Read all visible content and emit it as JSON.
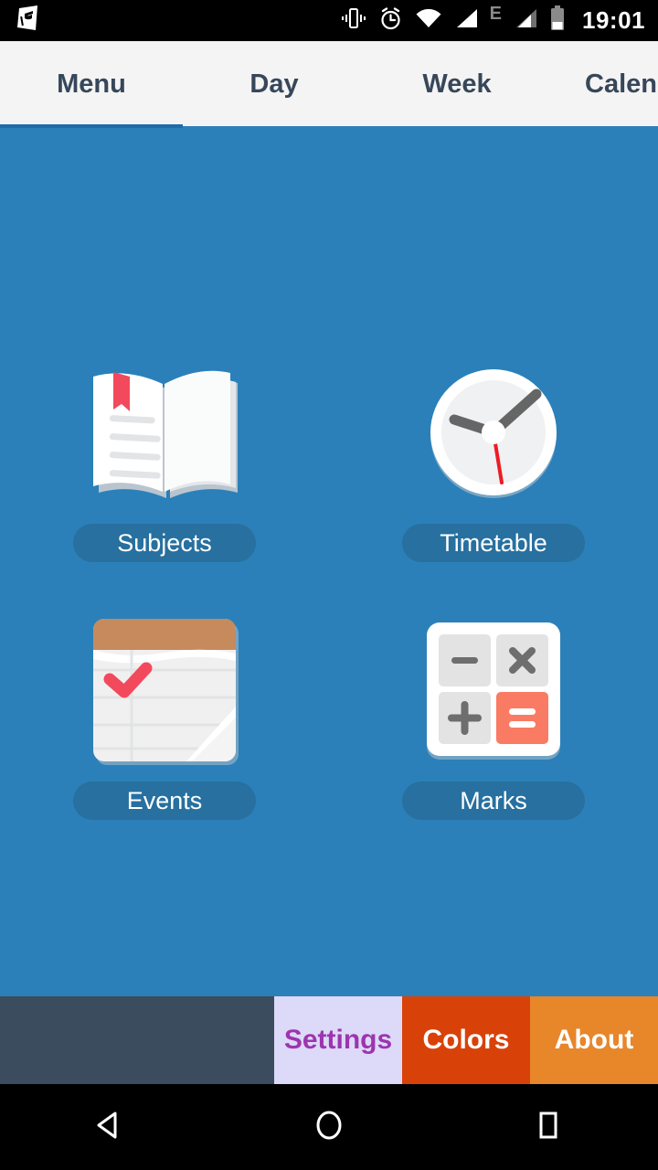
{
  "statusbar": {
    "app_notification_icon": "graduation-cap-icon",
    "icons": [
      "vibrate-icon",
      "alarm-icon",
      "wifi-icon",
      "signal-icon",
      "edge-network-icon",
      "signal-2-icon",
      "battery-icon"
    ],
    "network_label": "E",
    "time": "19:01"
  },
  "tabs": [
    {
      "label": "Menu",
      "active": true
    },
    {
      "label": "Day",
      "active": false
    },
    {
      "label": "Week",
      "active": false
    },
    {
      "label": "Calendar",
      "active": false
    }
  ],
  "menu": {
    "items": [
      {
        "label": "Subjects",
        "icon": "open-book-icon"
      },
      {
        "label": "Timetable",
        "icon": "clock-icon"
      },
      {
        "label": "Events",
        "icon": "notepad-check-icon"
      },
      {
        "label": "Marks",
        "icon": "calculator-icon"
      }
    ]
  },
  "bottombar": {
    "settings_label": "Settings",
    "colors_label": "Colors",
    "about_label": "About"
  },
  "navbar": {
    "back": "back-triangle-icon",
    "home": "home-circle-icon",
    "recents": "recents-square-icon"
  },
  "colors": {
    "background": "#2B80B9",
    "tabbar": "#F4F4F4",
    "tab_text": "#37475A",
    "tab_indicator": "#1F6CA8",
    "label_pill": "#27709F",
    "bottom_empty": "#3A4C5E",
    "settings_bg": "#DDD9F8",
    "settings_text": "#9C35AF",
    "colors_bg": "#D84209",
    "about_bg": "#E8862A",
    "accent_red": "#F2495C",
    "notepad_top": "#C68A5C",
    "equals_key": "#FA7B63"
  }
}
